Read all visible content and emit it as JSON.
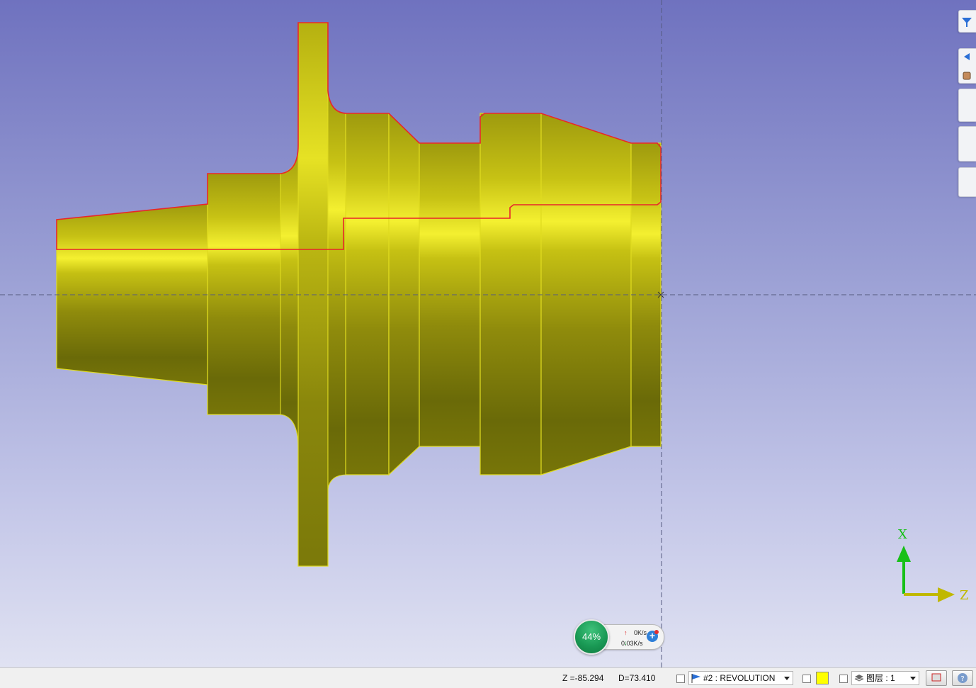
{
  "viewport": {
    "axis_x_label": "X",
    "axis_z_label": "Z",
    "part_color": "#c9c416",
    "outline_color": "#e8252a",
    "axis_x_color": "#18c018",
    "axis_z_color": "#c0b800"
  },
  "network_widget": {
    "percent": "44%",
    "upload_rate": "0K/s",
    "download_rate": "0.03K/s"
  },
  "statusbar": {
    "z_coord": "Z =-85.294",
    "d_coord": "D=73.410",
    "operation": "#2 : REVOLUTION",
    "layer_label": "图层 : 1",
    "current_color": "#ffff00"
  }
}
